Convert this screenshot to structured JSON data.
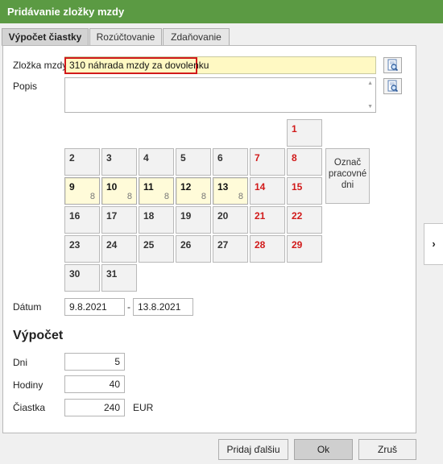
{
  "window": {
    "title": "Pridávanie zložky mzdy"
  },
  "tabs": [
    {
      "label": "Výpočet čiastky"
    },
    {
      "label": "Rozúčtovanie"
    },
    {
      "label": "Zdaňovanie"
    }
  ],
  "form": {
    "zlozka_label": "Zložka mzdy",
    "zlozka_value": "310  náhrada mzdy za dovolenku",
    "popis_label": "Popis",
    "popis_value": "",
    "datum_label": "Dátum",
    "date_from": "9.8.2021",
    "date_sep": "-",
    "date_to": "13.8.2021"
  },
  "calendar": {
    "days": [
      {
        "day": "1",
        "weekend": true,
        "selected": false,
        "hours": ""
      },
      {
        "day": "2",
        "weekend": false,
        "selected": false,
        "hours": ""
      },
      {
        "day": "3",
        "weekend": false,
        "selected": false,
        "hours": ""
      },
      {
        "day": "4",
        "weekend": false,
        "selected": false,
        "hours": ""
      },
      {
        "day": "5",
        "weekend": false,
        "selected": false,
        "hours": ""
      },
      {
        "day": "6",
        "weekend": false,
        "selected": false,
        "hours": ""
      },
      {
        "day": "7",
        "weekend": true,
        "selected": false,
        "hours": ""
      },
      {
        "day": "8",
        "weekend": true,
        "selected": false,
        "hours": ""
      },
      {
        "day": "9",
        "weekend": false,
        "selected": true,
        "hours": "8"
      },
      {
        "day": "10",
        "weekend": false,
        "selected": true,
        "hours": "8"
      },
      {
        "day": "11",
        "weekend": false,
        "selected": true,
        "hours": "8"
      },
      {
        "day": "12",
        "weekend": false,
        "selected": true,
        "hours": "8"
      },
      {
        "day": "13",
        "weekend": false,
        "selected": true,
        "hours": "8"
      },
      {
        "day": "14",
        "weekend": true,
        "selected": false,
        "hours": ""
      },
      {
        "day": "15",
        "weekend": true,
        "selected": false,
        "hours": ""
      },
      {
        "day": "16",
        "weekend": false,
        "selected": false,
        "hours": ""
      },
      {
        "day": "17",
        "weekend": false,
        "selected": false,
        "hours": ""
      },
      {
        "day": "18",
        "weekend": false,
        "selected": false,
        "hours": ""
      },
      {
        "day": "19",
        "weekend": false,
        "selected": false,
        "hours": ""
      },
      {
        "day": "20",
        "weekend": false,
        "selected": false,
        "hours": ""
      },
      {
        "day": "21",
        "weekend": true,
        "selected": false,
        "hours": ""
      },
      {
        "day": "22",
        "weekend": true,
        "selected": false,
        "hours": ""
      },
      {
        "day": "23",
        "weekend": false,
        "selected": false,
        "hours": ""
      },
      {
        "day": "24",
        "weekend": false,
        "selected": false,
        "hours": ""
      },
      {
        "day": "25",
        "weekend": false,
        "selected": false,
        "hours": ""
      },
      {
        "day": "26",
        "weekend": false,
        "selected": false,
        "hours": ""
      },
      {
        "day": "27",
        "weekend": false,
        "selected": false,
        "hours": ""
      },
      {
        "day": "28",
        "weekend": true,
        "selected": false,
        "hours": ""
      },
      {
        "day": "29",
        "weekend": true,
        "selected": false,
        "hours": ""
      },
      {
        "day": "30",
        "weekend": false,
        "selected": false,
        "hours": ""
      },
      {
        "day": "31",
        "weekend": false,
        "selected": false,
        "hours": ""
      }
    ],
    "mark_workdays_line1": "Označ",
    "mark_workdays_line2": "pracovné",
    "mark_workdays_line3": "dni"
  },
  "vypocet": {
    "heading": "Výpočet",
    "dni_label": "Dni",
    "dni_value": "5",
    "hodiny_label": "Hodiny",
    "hodiny_value": "40",
    "ciastka_label": "Čiastka",
    "ciastka_value": "240",
    "currency": "EUR"
  },
  "buttons": {
    "add_next": "Pridaj ďalšiu",
    "ok": "Ok",
    "cancel": "Zruš"
  },
  "icons": {
    "lookup": "search-document-icon",
    "side": "chevron-right-icon"
  },
  "colors": {
    "titlebar": "#5b9a43",
    "weekend": "#d11a1a",
    "selected_day": "#fffbd9",
    "highlight": "#d11a1a",
    "zlozka_bg": "#fff9c3"
  }
}
